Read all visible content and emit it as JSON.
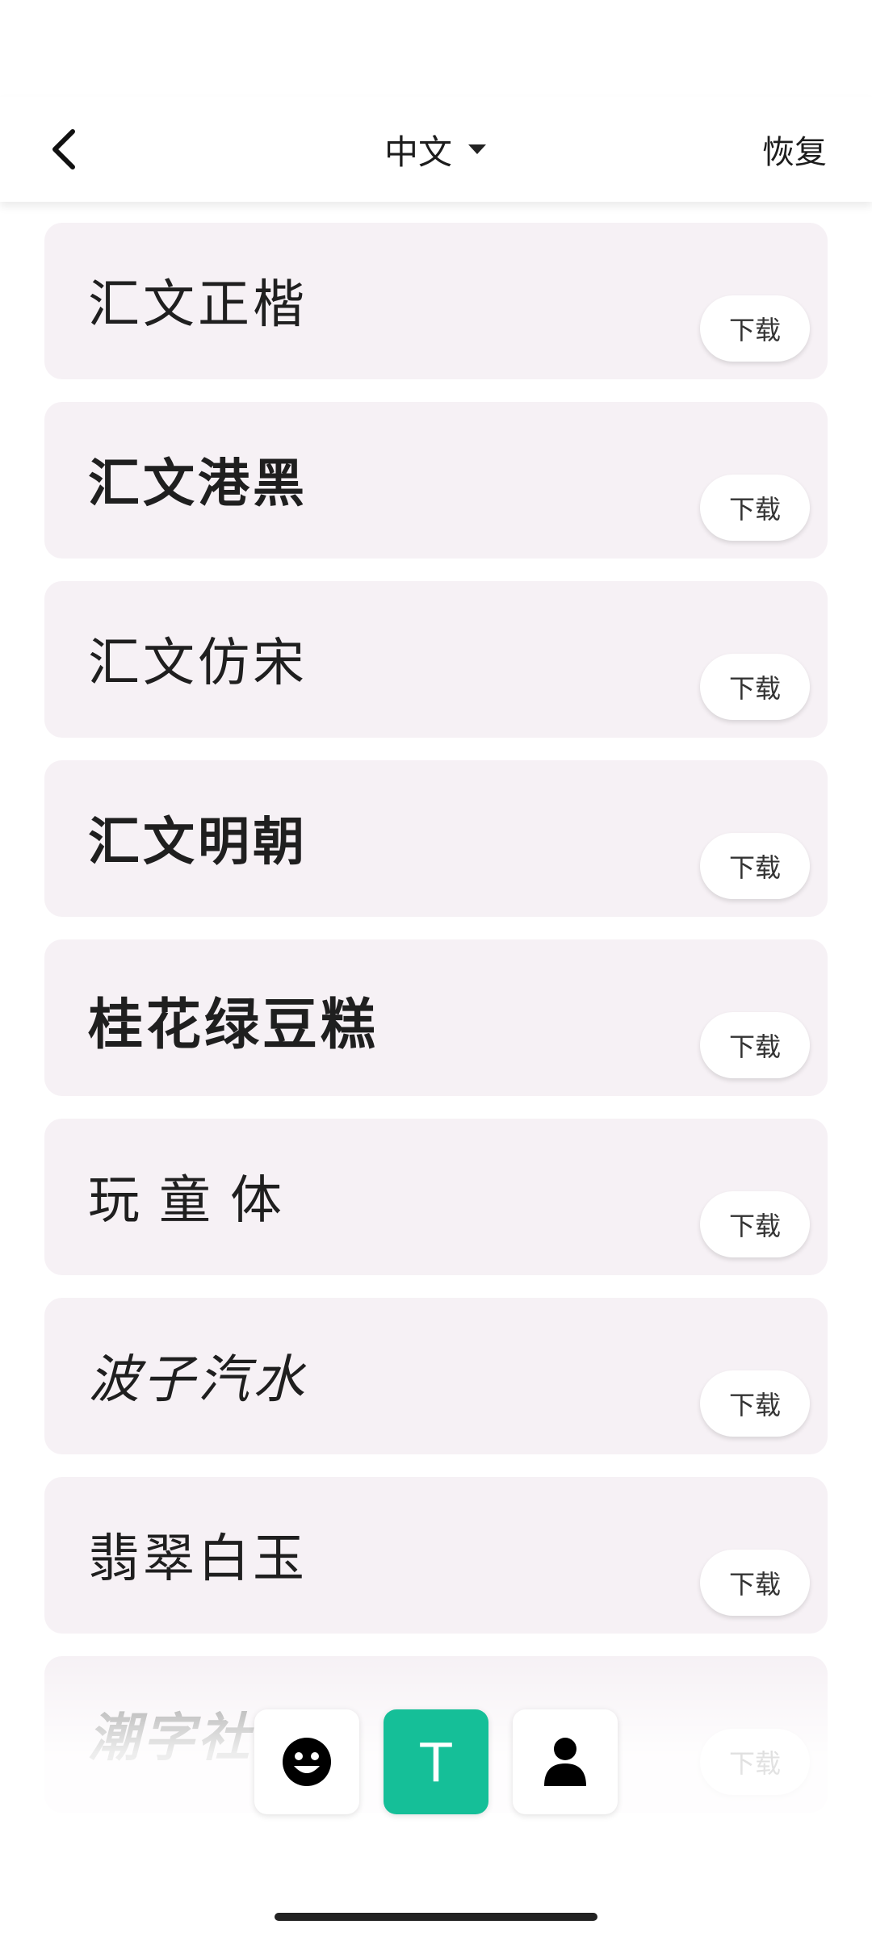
{
  "header": {
    "title": "中文",
    "restore_label": "恢复"
  },
  "fonts": [
    {
      "name": "汇文正楷",
      "download_label": "下载"
    },
    {
      "name": "汇文港黑",
      "download_label": "下载"
    },
    {
      "name": "汇文仿宋",
      "download_label": "下载"
    },
    {
      "name": "汇文明朝",
      "download_label": "下载"
    },
    {
      "name": "桂花绿豆糕",
      "download_label": "下载"
    },
    {
      "name": "玩童体",
      "download_label": "下载"
    },
    {
      "name": "波子汽水",
      "download_label": "下载"
    },
    {
      "name": "翡翠白玉",
      "download_label": "下载"
    },
    {
      "name": "潮字社",
      "download_label": "下载"
    }
  ],
  "nav": {
    "items": [
      {
        "icon": "smiley-icon"
      },
      {
        "icon": "text-icon",
        "label": "T",
        "active": true
      },
      {
        "icon": "person-icon"
      }
    ]
  },
  "colors": {
    "accent": "#15bf98",
    "card_bg": "#f6f1f5"
  }
}
